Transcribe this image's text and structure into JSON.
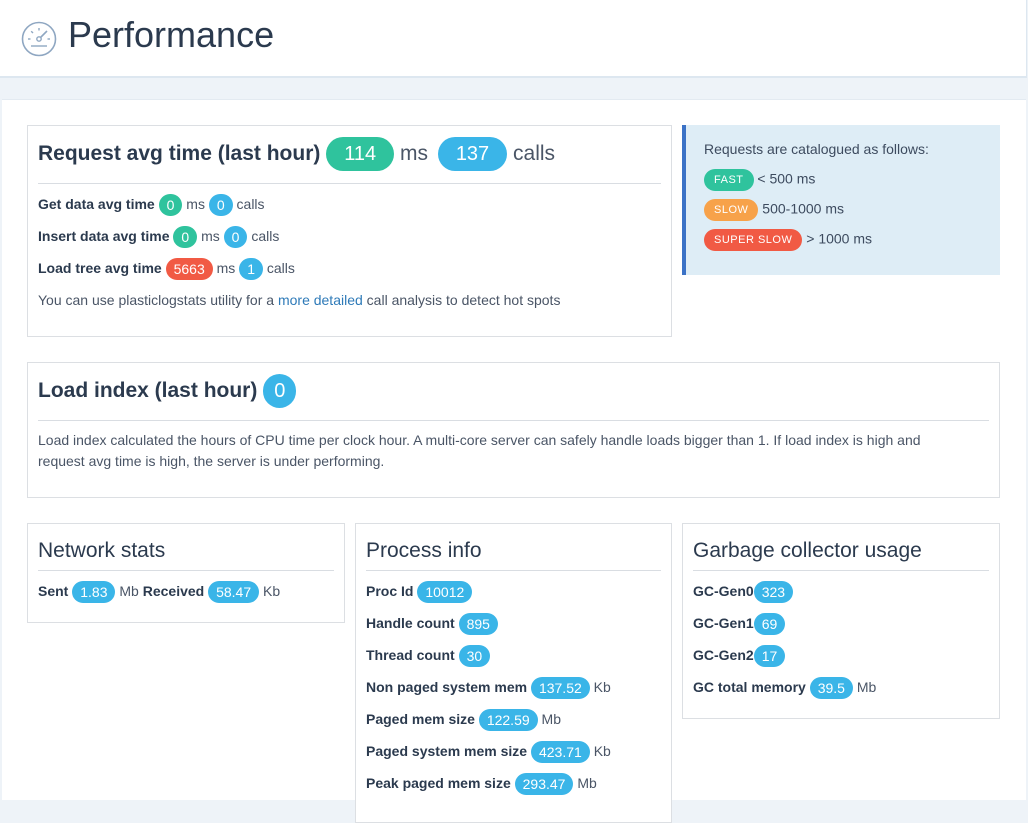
{
  "header": {
    "title": "Performance",
    "icon": "gauge-icon"
  },
  "request": {
    "title": "Request avg time (last hour)",
    "avg": "114",
    "avg_unit": "ms",
    "calls": "137",
    "calls_unit": "calls",
    "rows": [
      {
        "label": "Get data avg time",
        "ms": "0",
        "ms_unit": "ms",
        "calls": "0",
        "calls_unit": "calls"
      },
      {
        "label": "Insert data avg time",
        "ms": "0",
        "ms_unit": "ms",
        "calls": "0",
        "calls_unit": "calls"
      },
      {
        "label": "Load tree avg time",
        "ms": "5663",
        "ms_unit": "ms",
        "calls": "1",
        "calls_unit": "calls"
      }
    ],
    "note_pre": "You can use plasticlogstats utility for a ",
    "note_link": "more detailed",
    "note_post": " call analysis to detect hot spots"
  },
  "catalog": {
    "intro": "Requests are catalogued as follows:",
    "fast_tag": "FAST",
    "fast_text": "< 500 ms",
    "slow_tag": "SLOW",
    "slow_text": "500-1000 ms",
    "super_tag": "SUPER SLOW",
    "super_text": "> 1000 ms"
  },
  "load": {
    "title": "Load index (last hour)",
    "value": "0",
    "desc1": "Load index calculated the hours of CPU time per clock hour. A multi-core server can safely handle loads bigger than 1. If load index is high and",
    "desc2": "request avg time is high, the server is under performing."
  },
  "network": {
    "title": "Network stats",
    "sent_label": "Sent",
    "sent": "1.83",
    "sent_unit": "Mb",
    "recv_label": "Received",
    "recv": "58.47",
    "recv_unit": "Kb"
  },
  "process": {
    "title": "Process info",
    "rows": [
      {
        "label": "Proc Id",
        "value": "10012",
        "unit": ""
      },
      {
        "label": "Handle count",
        "value": "895",
        "unit": ""
      },
      {
        "label": "Thread count",
        "value": "30",
        "unit": ""
      },
      {
        "label": "Non paged system mem",
        "value": "137.52",
        "unit": "Kb"
      },
      {
        "label": "Paged mem size",
        "value": "122.59",
        "unit": "Mb"
      },
      {
        "label": "Paged system mem size",
        "value": "423.71",
        "unit": "Kb"
      },
      {
        "label": "Peak paged mem size",
        "value": "293.47",
        "unit": "Mb"
      }
    ]
  },
  "gc": {
    "title": "Garbage collector usage",
    "rows": [
      {
        "label": "GC-Gen0",
        "value": "323",
        "unit": ""
      },
      {
        "label": "GC-Gen1",
        "value": "69",
        "unit": ""
      },
      {
        "label": "GC-Gen2",
        "value": "17",
        "unit": ""
      },
      {
        "label": "GC total memory",
        "value": "39.5",
        "unit": "Mb"
      }
    ]
  },
  "colors": {
    "fast": "#2fc39d",
    "slow": "#f7a24a",
    "super_slow": "#f15a44",
    "value": "#3ab5e8",
    "accent": "#3b72c6"
  }
}
